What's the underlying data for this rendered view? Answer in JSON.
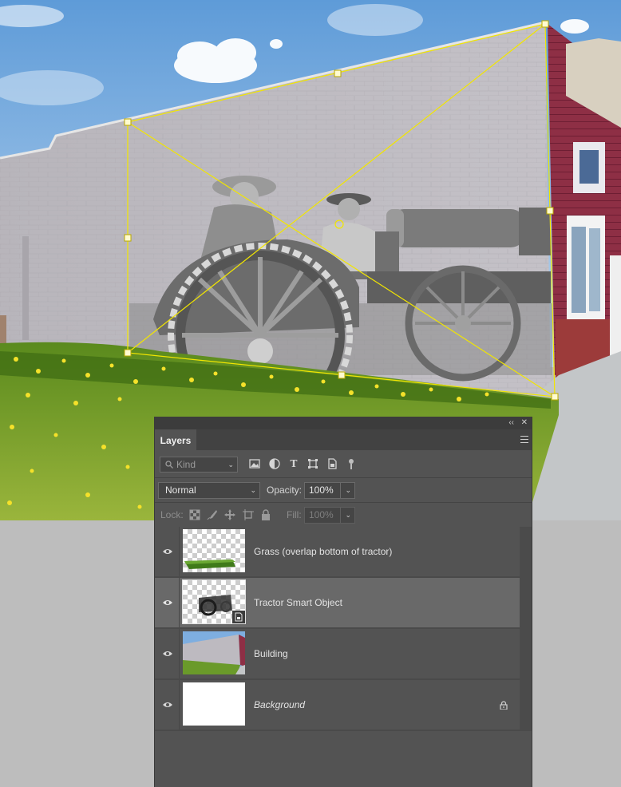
{
  "panel": {
    "tab_label": "Layers",
    "collapse_glyph": "‹‹",
    "close_glyph": "✕",
    "menu_icon": "hamburger-menu-icon"
  },
  "filter": {
    "kind_placeholder": "Kind",
    "icons": [
      "pixel-filter-icon",
      "adjustment-filter-icon",
      "type-filter-icon",
      "shape-filter-icon",
      "smart-object-filter-icon",
      "filter-toggle-icon"
    ]
  },
  "blend": {
    "mode": "Normal",
    "opacity_label": "Opacity:",
    "opacity_value": "100%"
  },
  "lock": {
    "label": "Lock:",
    "fill_label": "Fill:",
    "fill_value": "100%",
    "icons": [
      "lock-transparent-pixels-icon",
      "lock-image-pixels-icon",
      "lock-position-icon",
      "lock-artboard-icon",
      "lock-all-icon"
    ]
  },
  "layers": [
    {
      "name": "Grass (overlap bottom of tractor)",
      "visible": true,
      "selected": false,
      "italic": false,
      "locked": false
    },
    {
      "name": "Tractor Smart Object",
      "visible": true,
      "selected": true,
      "italic": false,
      "locked": false,
      "smart_object": true
    },
    {
      "name": "Building",
      "visible": true,
      "selected": false,
      "italic": false,
      "locked": false
    },
    {
      "name": "Background",
      "visible": true,
      "selected": false,
      "italic": true,
      "locked": true
    }
  ],
  "colors": {
    "transform_handles": "#f2e600",
    "panel_bg": "#535353",
    "selected_row": "#696969"
  }
}
